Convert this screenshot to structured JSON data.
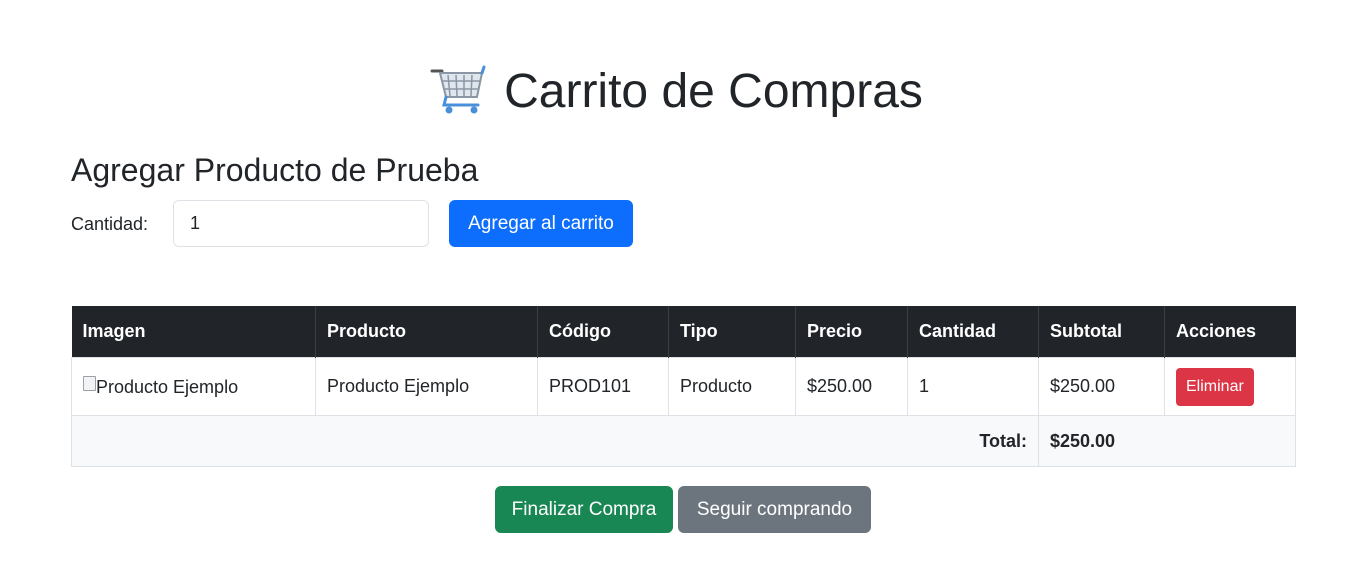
{
  "page": {
    "title": "Carrito de Compras",
    "icon": "shopping-cart-icon"
  },
  "add_section": {
    "title": "Agregar Producto de Prueba",
    "quantity_label": "Cantidad:",
    "quantity_value": "1",
    "add_button": "Agregar al carrito"
  },
  "table": {
    "headers": [
      "Imagen",
      "Producto",
      "Código",
      "Tipo",
      "Precio",
      "Cantidad",
      "Subtotal",
      "Acciones"
    ],
    "rows": [
      {
        "image_alt": "Producto Ejemplo",
        "product": "Producto Ejemplo",
        "code": "PROD101",
        "type": "Producto",
        "price": "$250.00",
        "quantity": "1",
        "subtotal": "$250.00",
        "action": "Eliminar"
      }
    ],
    "total_label": "Total:",
    "total_value": "$250.00"
  },
  "footer": {
    "checkout_button": "Finalizar Compra",
    "continue_button": "Seguir comprando"
  },
  "colors": {
    "primary": "#0d6efd",
    "success": "#198754",
    "secondary": "#6c757d",
    "danger": "#dc3545",
    "header_dark": "#212529"
  }
}
